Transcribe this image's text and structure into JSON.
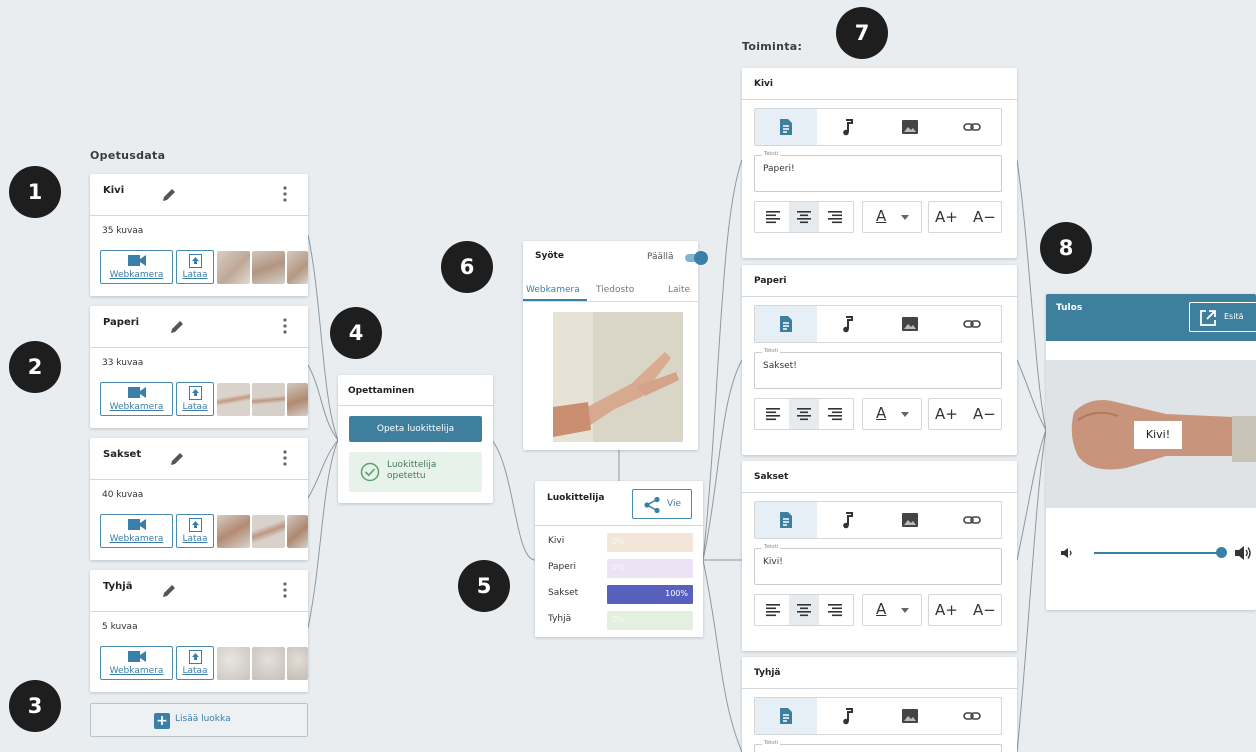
{
  "badges": [
    "1",
    "2",
    "3",
    "4",
    "5",
    "6",
    "7",
    "8"
  ],
  "training_data": {
    "title": "Opetusdata",
    "classes": [
      {
        "name": "Kivi",
        "count": "35 kuvaa"
      },
      {
        "name": "Paperi",
        "count": "33 kuvaa"
      },
      {
        "name": "Sakset",
        "count": "40 kuvaa"
      },
      {
        "name": "Tyhjä",
        "count": "5 kuvaa"
      }
    ],
    "webcam_label": "Webkamera",
    "upload_label": "Lataa",
    "add_class_label": "Lisää luokka"
  },
  "training": {
    "title": "Opettaminen",
    "train_button": "Opeta luokittelija",
    "status": "Luokittelija opetettu"
  },
  "input": {
    "title": "Syöte",
    "toggle_label": "Päällä",
    "tabs": [
      "Webkamera",
      "Tiedosto",
      "Laite"
    ],
    "active_tab": "Webkamera"
  },
  "classifier": {
    "title": "Luokittelija",
    "export_label": "Vie",
    "rows": [
      {
        "label": "Kivi",
        "percent": "0%",
        "value": 0,
        "color": "#f1e6d8"
      },
      {
        "label": "Paperi",
        "percent": "0%",
        "value": 0,
        "color": "#ece3f4"
      },
      {
        "label": "Sakset",
        "percent": "100%",
        "value": 100,
        "color": "#5761bd"
      },
      {
        "label": "Tyhjä",
        "percent": "0%",
        "value": 0,
        "color": "#e3efdf"
      }
    ]
  },
  "actions": {
    "title": "Toiminta:",
    "field_label": "Teksti",
    "cards": [
      {
        "name": "Kivi",
        "text": "Paperi!"
      },
      {
        "name": "Paperi",
        "text": "Sakset!"
      },
      {
        "name": "Sakset",
        "text": "Kivi!"
      },
      {
        "name": "Tyhjä",
        "text": ""
      }
    ],
    "font_color_label": "A",
    "font_bigger": "A+",
    "font_smaller": "A−"
  },
  "output": {
    "title": "Tulos",
    "present_label": "Esitä",
    "result_text": "Kivi!",
    "volume_level": 1.0
  },
  "colors": {
    "accent": "#3a7fa8",
    "header": "#3f7f9e",
    "background": "#e9edf0"
  }
}
